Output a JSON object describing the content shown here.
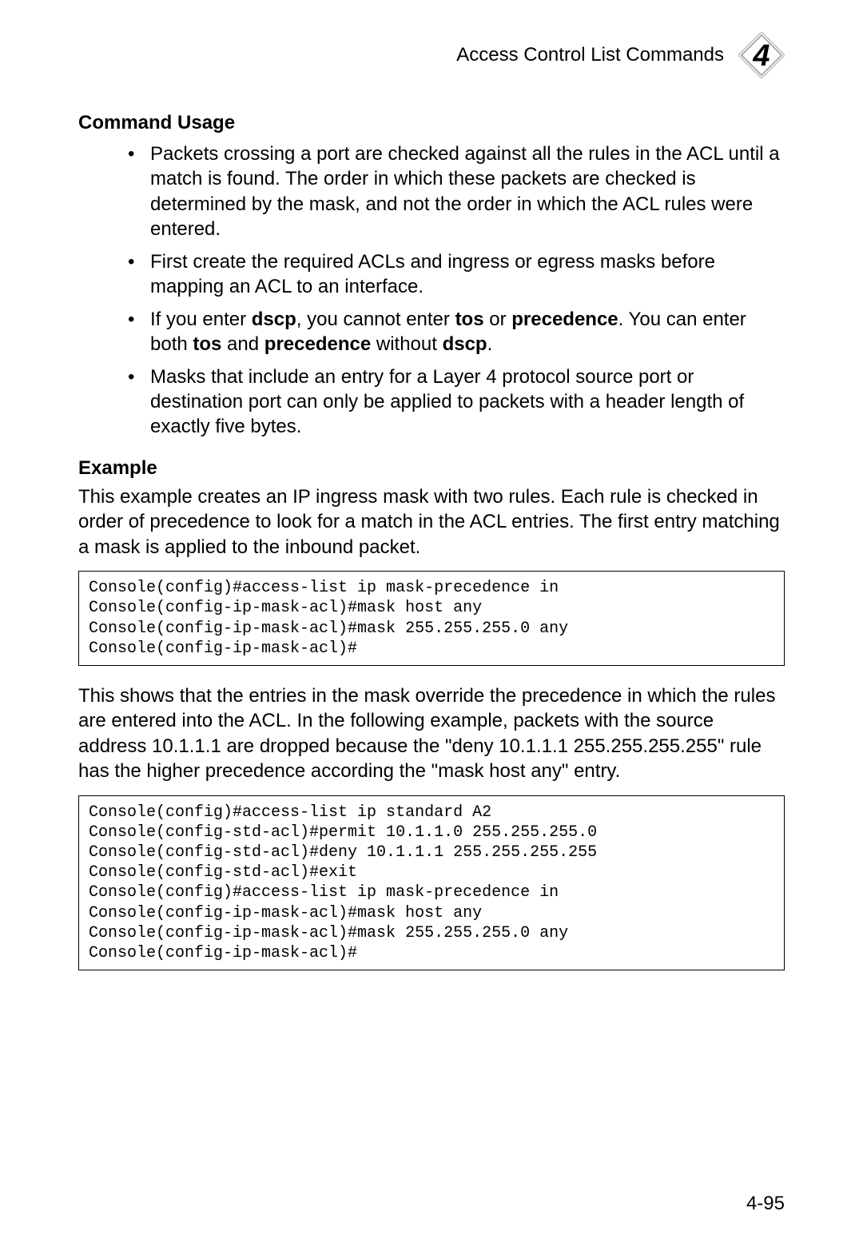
{
  "header": {
    "title": "Access Control List Commands",
    "chapter_number": "4"
  },
  "sections": {
    "command_usage_heading": "Command Usage",
    "example_heading": "Example"
  },
  "bullets": {
    "b1": "Packets crossing a port are checked against all the rules in the ACL until a match is found. The order in which these packets are checked is determined by the mask, and not the order in which the ACL rules were entered.",
    "b2": "First create the required ACLs and ingress or egress masks before mapping an ACL to an interface.",
    "b3_pre": "If you enter ",
    "b3_dscp": "dscp",
    "b3_mid1": ", you cannot enter ",
    "b3_tos": "tos",
    "b3_mid2": " or ",
    "b3_prec": "precedence",
    "b3_mid3": ". You can enter both ",
    "b3_tos2": "tos",
    "b3_and": " and ",
    "b3_prec2": "precedence",
    "b3_mid4": " without ",
    "b3_dscp2": "dscp",
    "b3_end": ".",
    "b4": "Masks that include an entry for a Layer 4 protocol source port or destination port can only be applied to packets with a header length of exactly five bytes."
  },
  "paras": {
    "p1": "This example creates an IP ingress mask with two rules. Each rule is checked in order of precedence to look for a match in the ACL entries. The first entry matching a mask is applied to the inbound packet.",
    "p2": "This shows that the entries in the mask override the precedence in which the rules are entered into the ACL. In the following example, packets with the source address 10.1.1.1 are dropped because the \"deny 10.1.1.1 255.255.255.255\" rule has the higher precedence according the \"mask host any\" entry."
  },
  "code": {
    "c1": "Console(config)#access-list ip mask-precedence in\nConsole(config-ip-mask-acl)#mask host any\nConsole(config-ip-mask-acl)#mask 255.255.255.0 any\nConsole(config-ip-mask-acl)#",
    "c2": "Console(config)#access-list ip standard A2\nConsole(config-std-acl)#permit 10.1.1.0 255.255.255.0\nConsole(config-std-acl)#deny 10.1.1.1 255.255.255.255\nConsole(config-std-acl)#exit\nConsole(config)#access-list ip mask-precedence in\nConsole(config-ip-mask-acl)#mask host any\nConsole(config-ip-mask-acl)#mask 255.255.255.0 any\nConsole(config-ip-mask-acl)#"
  },
  "page_number": "4-95"
}
